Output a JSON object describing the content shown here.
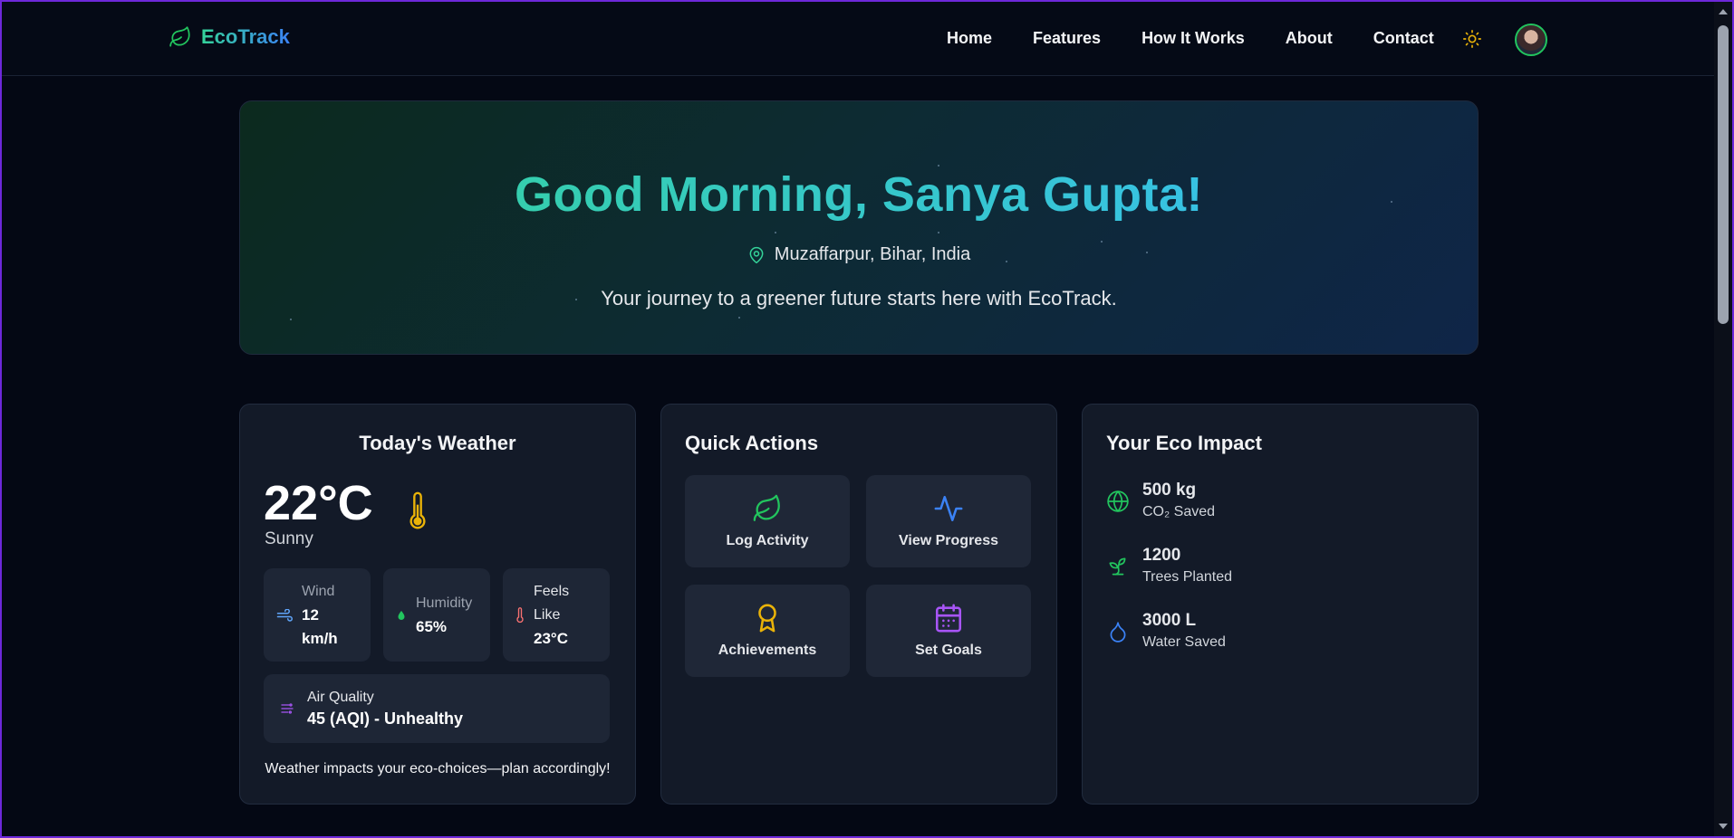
{
  "brand": {
    "name": "EcoTrack"
  },
  "nav": {
    "links": [
      "Home",
      "Features",
      "How It Works",
      "About",
      "Contact"
    ]
  },
  "hero": {
    "greeting": "Good Morning, Sanya Gupta!",
    "location": "Muzaffarpur, Bihar, India",
    "tagline": "Your journey to a greener future starts here with EcoTrack."
  },
  "weather": {
    "title": "Today's Weather",
    "temperature": "22°C",
    "condition": "Sunny",
    "wind": {
      "label": "Wind",
      "value": "12 km/h"
    },
    "humidity": {
      "label": "Humidity",
      "value": "65%"
    },
    "feels_like": {
      "label": "Feels Like",
      "value": "23°C"
    },
    "air_quality": {
      "label": "Air Quality",
      "value": "45 (AQI) - Unhealthy"
    },
    "note": "Weather impacts your eco-choices—plan accordingly!"
  },
  "quick_actions": {
    "title": "Quick Actions",
    "items": [
      {
        "label": "Log Activity",
        "icon": "leaf-icon"
      },
      {
        "label": "View Progress",
        "icon": "activity-icon"
      },
      {
        "label": "Achievements",
        "icon": "award-icon"
      },
      {
        "label": "Set Goals",
        "icon": "calendar-icon"
      }
    ]
  },
  "impact": {
    "title": "Your Eco Impact",
    "items": [
      {
        "value": "500 kg",
        "label": "CO₂ Saved",
        "icon": "globe-icon"
      },
      {
        "value": "1200",
        "label": "Trees Planted",
        "icon": "sprout-icon"
      },
      {
        "value": "3000 L",
        "label": "Water Saved",
        "icon": "droplet-icon"
      }
    ]
  },
  "colors": {
    "accent_green": "#22c55e",
    "accent_blue": "#3b82f6",
    "accent_yellow": "#eab308",
    "accent_purple": "#a855f7"
  }
}
